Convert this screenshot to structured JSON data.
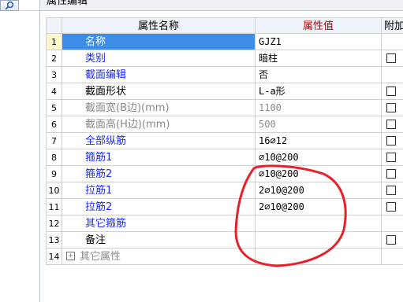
{
  "panel": {
    "title": "属性编辑"
  },
  "columns": {
    "name": "属性名称",
    "value": "属性值",
    "extra": "附加"
  },
  "rows": [
    {
      "num": "1",
      "name": "名称",
      "value": "GJZ1",
      "style": "blue",
      "checkbox": false,
      "selected": true
    },
    {
      "num": "2",
      "name": "类别",
      "value": "暗柱",
      "style": "blue",
      "checkbox": true
    },
    {
      "num": "3",
      "name": "截面编辑",
      "value": "否",
      "style": "blue",
      "checkbox": false
    },
    {
      "num": "4",
      "name": "截面形状",
      "value": "L-a形",
      "style": "black",
      "checkbox": true
    },
    {
      "num": "5",
      "name": "截面宽(B边)(mm)",
      "value": "1100",
      "style": "gray",
      "checkbox": true
    },
    {
      "num": "6",
      "name": "截面高(H边)(mm)",
      "value": "500",
      "style": "gray",
      "checkbox": true
    },
    {
      "num": "7",
      "name": "全部纵筋",
      "value": "16⌀12",
      "style": "blue",
      "checkbox": true
    },
    {
      "num": "8",
      "name": "箍筋1",
      "value": "⌀10@200",
      "style": "blue",
      "checkbox": true
    },
    {
      "num": "9",
      "name": "箍筋2",
      "value": "⌀10@200",
      "style": "blue",
      "checkbox": true
    },
    {
      "num": "10",
      "name": "拉筋1",
      "value": "2⌀10@200",
      "style": "blue",
      "checkbox": true
    },
    {
      "num": "11",
      "name": "拉筋2",
      "value": "2⌀10@200",
      "style": "blue",
      "checkbox": true
    },
    {
      "num": "12",
      "name": "其它箍筋",
      "value": "",
      "style": "blue",
      "checkbox": false
    },
    {
      "num": "13",
      "name": "备注",
      "value": "",
      "style": "black",
      "checkbox": true
    },
    {
      "num": "14",
      "name": "其它属性",
      "value": "",
      "style": "gray",
      "checkbox": false,
      "expander": "+"
    }
  ],
  "annotation": {
    "color": "#e8202a"
  }
}
